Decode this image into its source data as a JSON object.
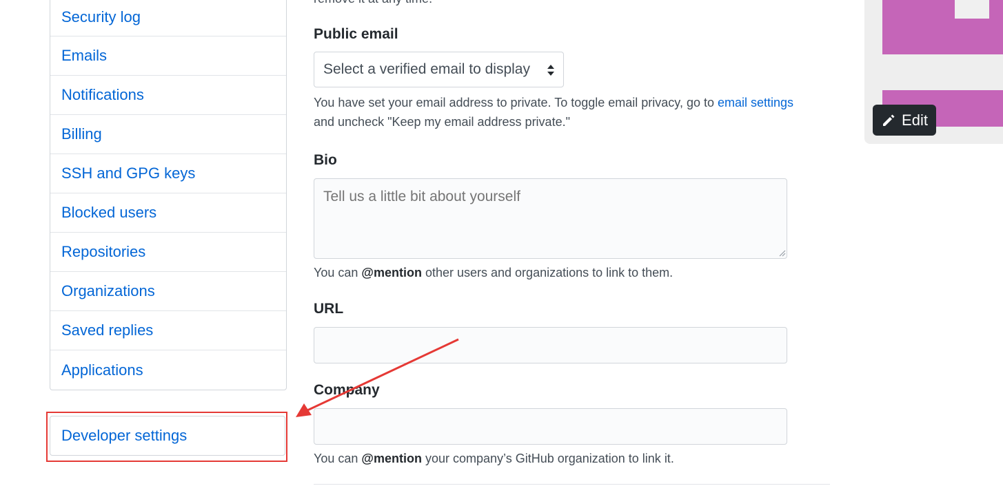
{
  "sidebar": {
    "items": [
      {
        "label": "Security log"
      },
      {
        "label": "Emails"
      },
      {
        "label": "Notifications"
      },
      {
        "label": "Billing"
      },
      {
        "label": "SSH and GPG keys"
      },
      {
        "label": "Blocked users"
      },
      {
        "label": "Repositories"
      },
      {
        "label": "Organizations"
      },
      {
        "label": "Saved replies"
      },
      {
        "label": "Applications"
      }
    ],
    "developer_settings": "Developer settings"
  },
  "form": {
    "cut_text": "remove it at any time.",
    "public_email": {
      "label": "Public email",
      "selected": "Select a verified email to display",
      "note_prefix": "You have set your email address to private. To toggle email privacy, go to ",
      "note_link": "email settings",
      "note_suffix": "and uncheck \"Keep my email address private.\""
    },
    "bio": {
      "label": "Bio",
      "placeholder": "Tell us a little bit about yourself",
      "note_prefix": "You can ",
      "note_mention": "@mention",
      "note_suffix": " other users and organizations to link to them."
    },
    "url": {
      "label": "URL",
      "value": ""
    },
    "company": {
      "label": "Company",
      "value": "",
      "note_prefix": "You can ",
      "note_mention": "@mention",
      "note_suffix": " your company’s GitHub organization to link it."
    }
  },
  "avatar": {
    "edit_label": "Edit",
    "color": "#c565b8"
  },
  "annotation": {
    "color": "#e53935"
  }
}
